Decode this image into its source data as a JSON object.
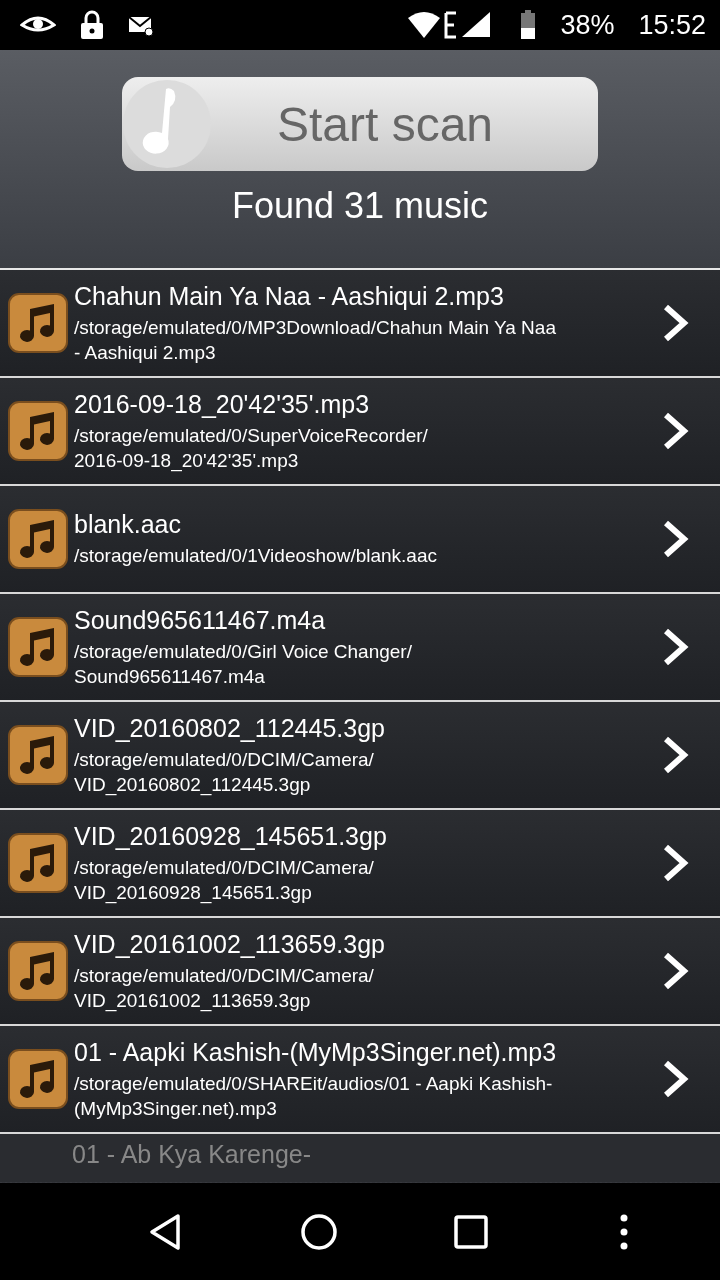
{
  "status_bar": {
    "battery": "38%",
    "time": "15:52"
  },
  "scan_button": {
    "label": "Start scan"
  },
  "found_label": "Found 31 music",
  "files": [
    {
      "title": "Chahun Main Ya Naa - Aashiqui 2.mp3",
      "path": "/storage/emulated/0/MP3Download/Chahun Main Ya Naa\n- Aashiqui 2.mp3"
    },
    {
      "title": "2016-09-18_20'42'35'.mp3",
      "path": "/storage/emulated/0/SuperVoiceRecorder/\n2016-09-18_20'42'35'.mp3"
    },
    {
      "title": "blank.aac",
      "path": "/storage/emulated/0/1Videoshow/blank.aac"
    },
    {
      "title": "Sound965611467.m4a",
      "path": "/storage/emulated/0/Girl Voice Changer/\nSound965611467.m4a"
    },
    {
      "title": "VID_20160802_112445.3gp",
      "path": "/storage/emulated/0/DCIM/Camera/\nVID_20160802_112445.3gp"
    },
    {
      "title": "VID_20160928_145651.3gp",
      "path": "/storage/emulated/0/DCIM/Camera/\nVID_20160928_145651.3gp"
    },
    {
      "title": "VID_20161002_113659.3gp",
      "path": "/storage/emulated/0/DCIM/Camera/\nVID_20161002_113659.3gp"
    },
    {
      "title": "01 - Aapki Kashish-(MyMp3Singer.net).mp3",
      "path": "/storage/emulated/0/SHAREit/audios/01 - Aapki Kashish-\n(MyMp3Singer.net).mp3"
    }
  ],
  "partial_file": {
    "title": "01 - Ab Kya Karenge-"
  }
}
